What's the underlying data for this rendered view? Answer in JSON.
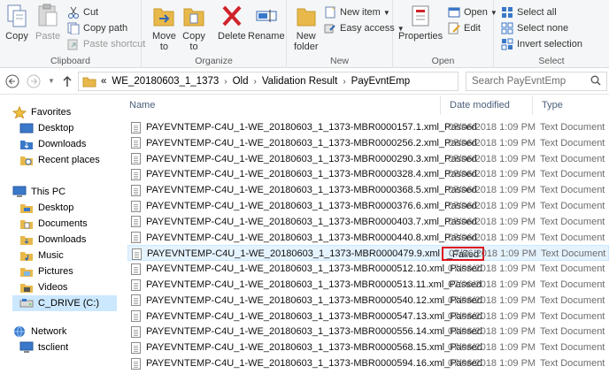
{
  "ribbon": {
    "clipboard": {
      "label": "Clipboard",
      "copy": "Copy",
      "paste": "Paste",
      "cut": "Cut",
      "copy_path": "Copy path",
      "paste_shortcut": "Paste shortcut"
    },
    "organize": {
      "label": "Organize",
      "move_to": "Move\nto",
      "copy_to": "Copy\nto",
      "delete": "Delete",
      "rename": "Rename"
    },
    "new": {
      "label": "New",
      "new_folder": "New\nfolder",
      "new_item": "New item",
      "easy_access": "Easy access"
    },
    "open": {
      "label": "Open",
      "properties": "Properties",
      "open": "Open",
      "edit": "Edit"
    },
    "select": {
      "label": "Select",
      "select_all": "Select all",
      "select_none": "Select none",
      "invert_selection": "Invert selection"
    }
  },
  "address": {
    "prefix": "«",
    "crumbs": [
      "WE_20180603_1_1373",
      "Old",
      "Validation Result",
      "PayEvntEmp"
    ],
    "search_placeholder": "Search PayEvntEmp"
  },
  "navpane": {
    "favorites": "Favorites",
    "desktop": "Desktop",
    "downloads": "Downloads",
    "recent_places": "Recent places",
    "this_pc": "This PC",
    "pc_desktop": "Desktop",
    "documents": "Documents",
    "pc_downloads": "Downloads",
    "music": "Music",
    "pictures": "Pictures",
    "videos": "Videos",
    "c_drive": "C_DRIVE (C:)",
    "network": "Network",
    "tsclient": "tsclient"
  },
  "columns": {
    "name": "Name",
    "date_modified": "Date modified",
    "type": "Type"
  },
  "files": [
    {
      "name": "PAYEVNTEMP-C4U_1-WE_20180603_1_1373-MBR0000157.1.xml_Passed",
      "date": "07/06/2018 1:09 PM",
      "type": "Text Document"
    },
    {
      "name": "PAYEVNTEMP-C4U_1-WE_20180603_1_1373-MBR0000256.2.xml_Passed",
      "date": "07/06/2018 1:09 PM",
      "type": "Text Document"
    },
    {
      "name": "PAYEVNTEMP-C4U_1-WE_20180603_1_1373-MBR0000290.3.xml_Passed",
      "date": "07/06/2018 1:09 PM",
      "type": "Text Document"
    },
    {
      "name": "PAYEVNTEMP-C4U_1-WE_20180603_1_1373-MBR0000328.4.xml_Passed",
      "date": "07/06/2018 1:09 PM",
      "type": "Text Document"
    },
    {
      "name": "PAYEVNTEMP-C4U_1-WE_20180603_1_1373-MBR0000368.5.xml_Passed",
      "date": "07/06/2018 1:09 PM",
      "type": "Text Document"
    },
    {
      "name": "PAYEVNTEMP-C4U_1-WE_20180603_1_1373-MBR0000376.6.xml_Passed",
      "date": "07/06/2018 1:09 PM",
      "type": "Text Document"
    },
    {
      "name": "PAYEVNTEMP-C4U_1-WE_20180603_1_1373-MBR0000403.7.xml_Passed",
      "date": "07/06/2018 1:09 PM",
      "type": "Text Document"
    },
    {
      "name": "PAYEVNTEMP-C4U_1-WE_20180603_1_1373-MBR0000440.8.xml_Passed",
      "date": "07/06/2018 1:09 PM",
      "type": "Text Document"
    },
    {
      "name": "PAYEVNTEMP-C4U_1-WE_20180603_1_1373-MBR0000479.9.xml",
      "suffix": "_Failed",
      "date": "07/06/2018 1:09 PM",
      "type": "Text Document"
    },
    {
      "name": "PAYEVNTEMP-C4U_1-WE_20180603_1_1373-MBR0000512.10.xml_Passed",
      "date": "07/06/2018 1:09 PM",
      "type": "Text Document"
    },
    {
      "name": "PAYEVNTEMP-C4U_1-WE_20180603_1_1373-MBR0000513.11.xml_Passed",
      "date": "07/06/2018 1:09 PM",
      "type": "Text Document"
    },
    {
      "name": "PAYEVNTEMP-C4U_1-WE_20180603_1_1373-MBR0000540.12.xml_Passed",
      "date": "07/06/2018 1:09 PM",
      "type": "Text Document"
    },
    {
      "name": "PAYEVNTEMP-C4U_1-WE_20180603_1_1373-MBR0000547.13.xml_Passed",
      "date": "07/06/2018 1:09 PM",
      "type": "Text Document"
    },
    {
      "name": "PAYEVNTEMP-C4U_1-WE_20180603_1_1373-MBR0000556.14.xml_Passed",
      "date": "07/06/2018 1:09 PM",
      "type": "Text Document"
    },
    {
      "name": "PAYEVNTEMP-C4U_1-WE_20180603_1_1373-MBR0000568.15.xml_Passed",
      "date": "07/06/2018 1:09 PM",
      "type": "Text Document"
    },
    {
      "name": "PAYEVNTEMP-C4U_1-WE_20180603_1_1373-MBR0000594.16.xml_Passed",
      "date": "07/06/2018 1:09 PM",
      "type": "Text Document"
    }
  ],
  "colors": {
    "highlight_border": "#e0141e",
    "selected_bg": "#cce8ff",
    "folder": "#e8b84a"
  }
}
